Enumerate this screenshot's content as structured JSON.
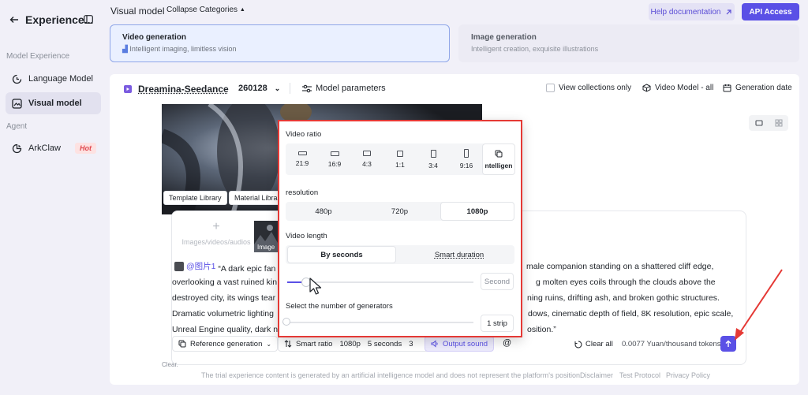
{
  "sidebar": {
    "title": "Experience...",
    "section_model": "Model Experience",
    "section_agent": "Agent",
    "items": [
      {
        "label": "Language Model"
      },
      {
        "label": "Visual model"
      },
      {
        "label": "ArkClaw",
        "badge": "Hot"
      }
    ]
  },
  "topbar": {
    "title": "Visual model",
    "collapse": "Collapse Categories",
    "help": "Help documentation",
    "api": "API Access"
  },
  "modes": [
    {
      "title": "Video generation",
      "subtitle": "Intelligent imaging, limitless vision"
    },
    {
      "title": "Image generation",
      "subtitle": "Intelligent creation, exquisite illustrations"
    }
  ],
  "toolbar": {
    "model_name": "Dreamina-Seedance",
    "model_version": "260128",
    "model_params": "Model parameters",
    "view_collections": "View collections only",
    "video_model": "Video Model - all",
    "generation_date": "Generation date"
  },
  "preview": {
    "template_library": "Template Library",
    "material_library": "Material Libra"
  },
  "prompt": {
    "upload_label": "Images/videos/audios",
    "thumb_label": "Image",
    "ref_tag": "@图片1",
    "line1_a": "“A dark epic fan",
    "line1_b": "male companion standing on a shattered cliff edge,",
    "line2_a": "overlooking a vast ruined kin",
    "line2_b": "g molten eyes coils through the clouds above the",
    "line3_a": "destroyed city, its wings tear",
    "line3_b": "ning ruins, drifting ash, and broken gothic structures.",
    "line4_a": "Dramatic volumetric lighting",
    "line4_b": "dows, cinematic depth of field, 8K resolution, epic scale,",
    "line5_a": "Unreal Engine quality, dark n",
    "line5_b": "osition.”",
    "below": "Clear."
  },
  "bottom_bar": {
    "reference": "Reference generation",
    "smart_ratio": "Smart ratio",
    "resolution": "1080p",
    "duration": "5 seconds",
    "count": "3",
    "output_sound": "Output sound",
    "at": "@",
    "clear_all": "Clear all",
    "price": "0.0077 Yuan/thousand tokens"
  },
  "popup": {
    "ratio_label": "Video ratio",
    "ratios": [
      "21:9",
      "16:9",
      "4:3",
      "1:1",
      "3:4",
      "9:16",
      "ntelligen"
    ],
    "selected_ratio_index": 6,
    "resolution_label": "resolution",
    "resolutions": [
      "480p",
      "720p",
      "1080p"
    ],
    "selected_resolution_index": 2,
    "length_label": "Video length",
    "length_modes": [
      "By seconds",
      "Smart duration"
    ],
    "selected_length_index": 0,
    "length_unit": "Second",
    "length_fraction": 0.0,
    "generators_label": "Select the number of generators",
    "generators_value": "1 strip",
    "generators_fraction": 0.0
  },
  "footer": {
    "disclaimer_text": "The trial experience content is generated by an artificial intelligence model and does not represent the platform's position.",
    "disclaimer": "Disclaimer",
    "test_protocol": "Test Protocol",
    "privacy": "Privacy Policy"
  },
  "colors": {
    "accent": "#5a50e6",
    "highlight_border": "#e53935",
    "arrow": "#e53935"
  }
}
